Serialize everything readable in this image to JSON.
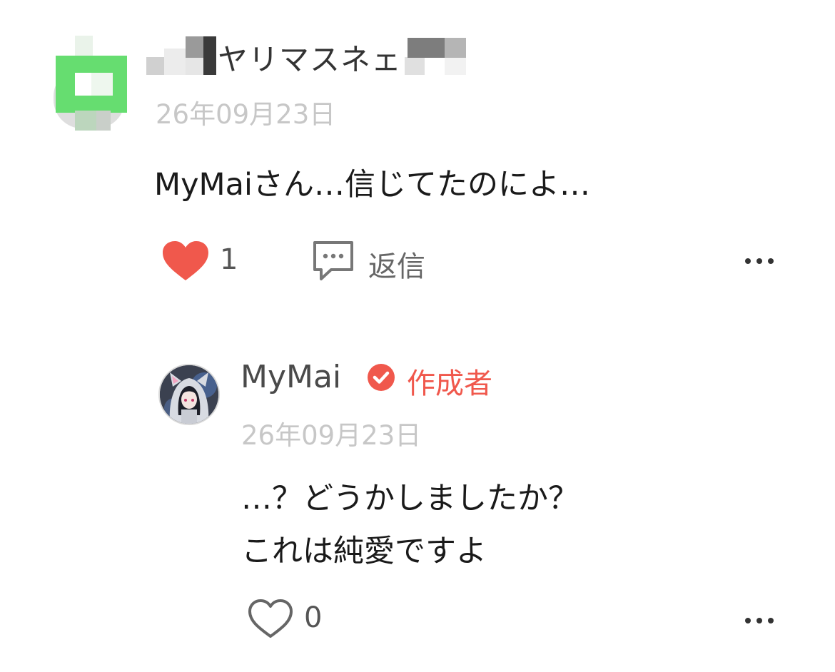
{
  "comment": {
    "author_name": "ヤリマスネェ",
    "date": "26年09月23日",
    "text": "MyMaiさん…信じてたのによ…",
    "like_count": "1",
    "reply_label": "返信"
  },
  "reply": {
    "author_name": "MyMai",
    "author_tag": "作成者",
    "date": "26年09月23日",
    "text_line1": "…？どうかしましたか？",
    "text_line2": "これは純愛ですよ",
    "like_count": "0"
  },
  "icons": {
    "liked_heart": "heart-filled-icon",
    "empty_heart": "heart-outline-icon",
    "reply": "speech-bubble-icon",
    "more": "more-dots-icon",
    "verified": "check-badge-icon"
  },
  "colors": {
    "accent": "#f0584c",
    "date_gray": "#c7c7c7",
    "avatar_green": "#5fe06a"
  }
}
